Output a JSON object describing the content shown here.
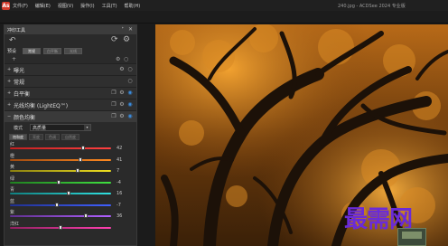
{
  "menu": {
    "app_icon": "As",
    "items": [
      "文件(F)",
      "编辑(E)",
      "视图(V)",
      "操作(I)",
      "工具(T)",
      "帮助(H)"
    ],
    "window_title": "240.jpg - ACDSee 2024 专业版"
  },
  "panel": {
    "title": "冲印工具",
    "pin_glyph": "📌",
    "close_glyph": "✕",
    "preset_label": "预设",
    "preset_tabs": [
      "常规",
      "白平衡",
      "光线"
    ],
    "sections": [
      {
        "label": "曝光",
        "icons": [
          "gear-icon",
          "power-icon"
        ]
      },
      {
        "label": "常规",
        "icons": [
          "power-icon"
        ]
      },
      {
        "label": "白平衡",
        "icons": [
          "copy-icon",
          "gear-icon",
          "power-icon"
        ]
      },
      {
        "label": "光线均衡 (LightEQ™)",
        "icons": [
          "copy-icon",
          "gear-icon",
          "power-icon"
        ]
      },
      {
        "label": "颜色均衡",
        "icons": [
          "copy-icon",
          "gear-icon",
          "power-icon"
        ]
      }
    ],
    "mode_label": "模式",
    "mode_value": "高质量",
    "subtabs": [
      "饱和度",
      "亮度",
      "色调",
      "自然度"
    ],
    "sliders": [
      {
        "label": "红",
        "value": "42",
        "level": 0.72,
        "colors": [
          "#c02020",
          "#ff4040"
        ]
      },
      {
        "label": "橙",
        "value": "41",
        "level": 0.7,
        "colors": [
          "#a04a10",
          "#ff8a20"
        ]
      },
      {
        "label": "黄",
        "value": "7",
        "level": 0.67,
        "colors": [
          "#8a8010",
          "#f0e020"
        ]
      },
      {
        "label": "绿",
        "value": "-4",
        "level": 0.48,
        "colors": [
          "#208020",
          "#40e040"
        ]
      },
      {
        "label": "青",
        "value": "16",
        "level": 0.58,
        "colors": [
          "#108080",
          "#30e0e0"
        ]
      },
      {
        "label": "蓝",
        "value": "-7",
        "level": 0.46,
        "colors": [
          "#203090",
          "#4060ff"
        ]
      },
      {
        "label": "紫",
        "value": "36",
        "level": 0.75,
        "colors": [
          "#603090",
          "#b060ff"
        ]
      },
      {
        "label": "洋红",
        "value": "",
        "level": 0.5,
        "colors": [
          "#902060",
          "#ff40b0"
        ]
      }
    ]
  },
  "watermark": {
    "text": "最需网"
  },
  "colors": {
    "accent": "#3a8de0",
    "app_icon": "#d23a2a",
    "watermark": "#6a2bd8"
  }
}
